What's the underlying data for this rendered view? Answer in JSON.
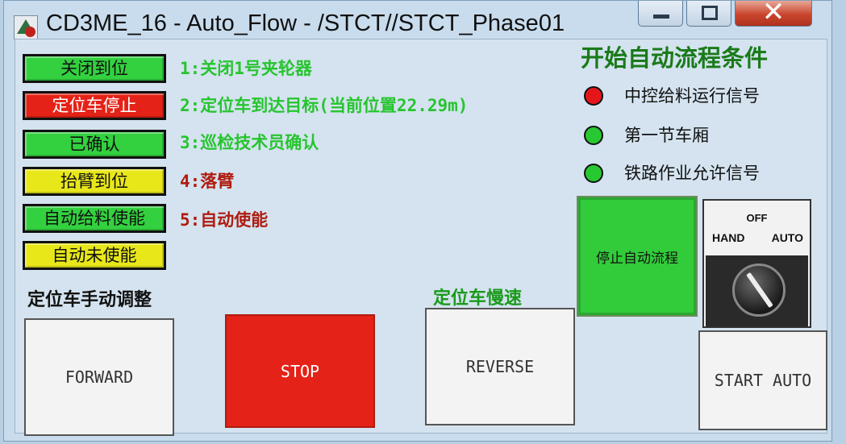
{
  "window": {
    "title": "CD3ME_16 - Auto_Flow - /STCT//STCT_Phase01",
    "close_glyph": "✕"
  },
  "status_buttons": [
    {
      "label": "关闭到位",
      "color": "#33d13f"
    },
    {
      "label": "定位车停止",
      "color": "#e52217"
    },
    {
      "label": "已确认",
      "color": "#33d13f"
    },
    {
      "label": "抬臂到位",
      "color": "#e8e71a"
    },
    {
      "label": "自动给料使能",
      "color": "#33d13f"
    },
    {
      "label": "自动未使能",
      "color": "#e8e71a"
    }
  ],
  "steps": [
    {
      "text": "1:关闭1号夹轮器",
      "color": "#27c42f"
    },
    {
      "text": "2:定位车到达目标(当前位置22.29m)",
      "color": "#27c42f"
    },
    {
      "text": "3:巡检技术员确认",
      "color": "#27c42f"
    },
    {
      "text": "4:落臂",
      "color": "#b01c10"
    },
    {
      "text": "5:自动使能",
      "color": "#b01c10"
    }
  ],
  "conditions": {
    "title": "开始自动流程条件",
    "items": [
      {
        "label": "中控给料运行信号",
        "state": "red"
      },
      {
        "label": "第一节车厢",
        "state": "green"
      },
      {
        "label": "铁路作业允许信号",
        "state": "green"
      }
    ]
  },
  "stop_auto_button": "停止自动流程",
  "selector": {
    "off": "OFF",
    "hand": "HAND",
    "auto": "AUTO",
    "position": "AUTO"
  },
  "manual": {
    "title": "定位车手动调整",
    "slow_title": "定位车慢速",
    "forward": "FORWARD",
    "stop": "STOP",
    "reverse": "REVERSE"
  },
  "start_auto_button": "START AUTO"
}
